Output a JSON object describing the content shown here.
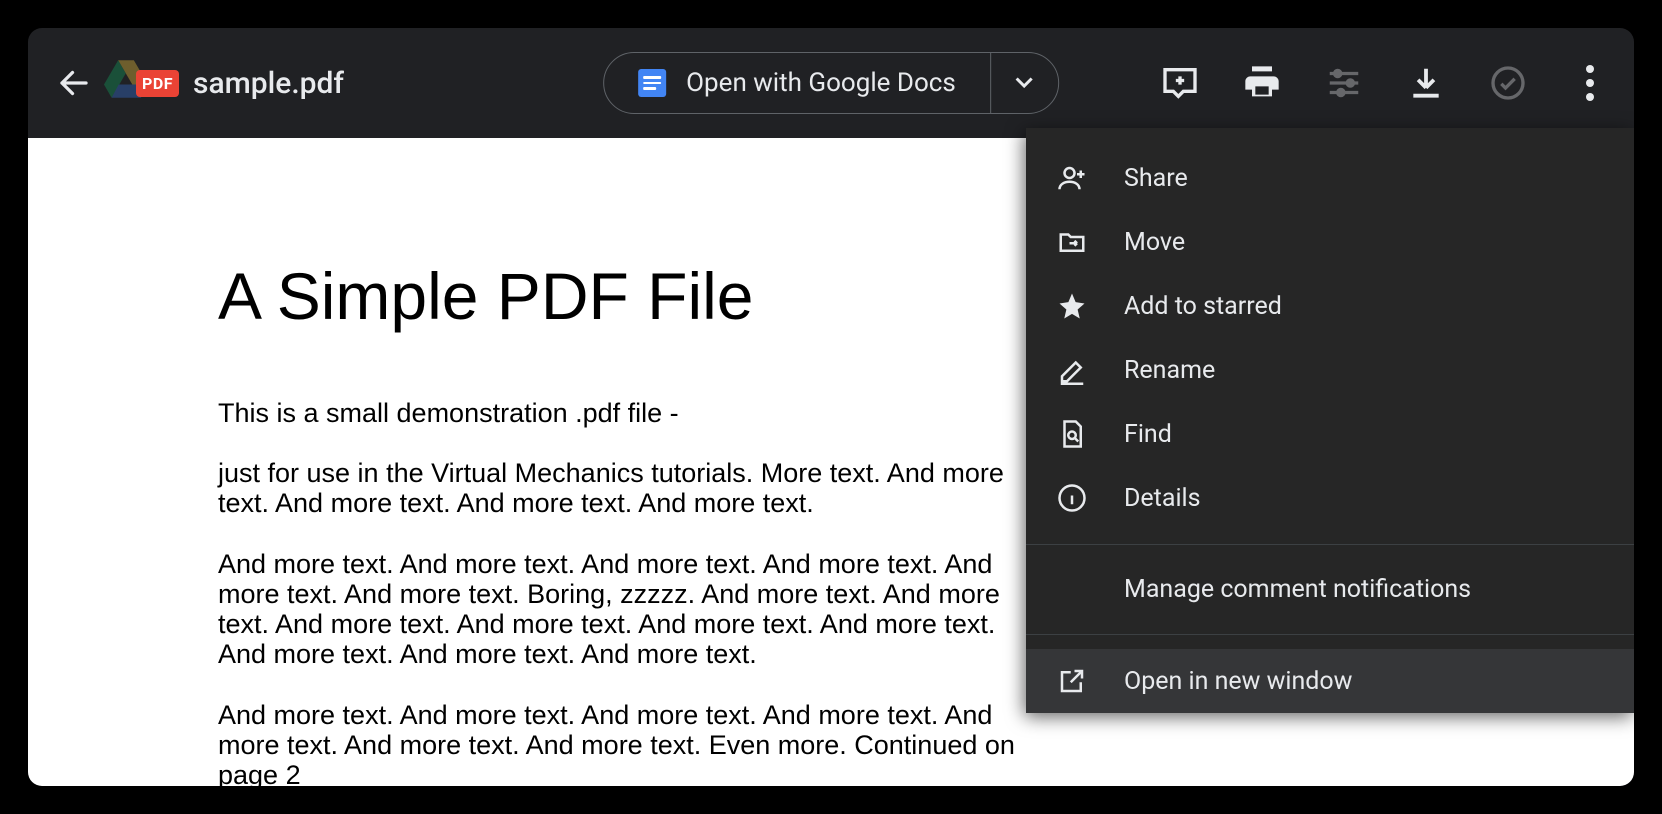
{
  "header": {
    "pdf_badge": "PDF",
    "filename": "sample.pdf",
    "open_button_label": "Open with Google Docs"
  },
  "doc": {
    "title": "A Simple PDF File",
    "p1": "This is a small demonstration .pdf file -",
    "p2": "just for use in the Virtual Mechanics tutorials. More text. And more text. And more text. And more text. And more text.",
    "p3": "And more text. And more text. And more text. And more text. And more text. And more text. Boring, zzzzz. And more text. And more text. And more text. And more text. And more text. And more text. And more text. And more text. And more text.",
    "p4": "And more text. And more text. And more text. And more text. And more text. And more text. And more text. Even more. Continued on page 2"
  },
  "menu": {
    "share": "Share",
    "move": "Move",
    "star": "Add to starred",
    "rename": "Rename",
    "find": "Find",
    "details": "Details",
    "notifications": "Manage comment notifications",
    "new_window": "Open in new window"
  }
}
